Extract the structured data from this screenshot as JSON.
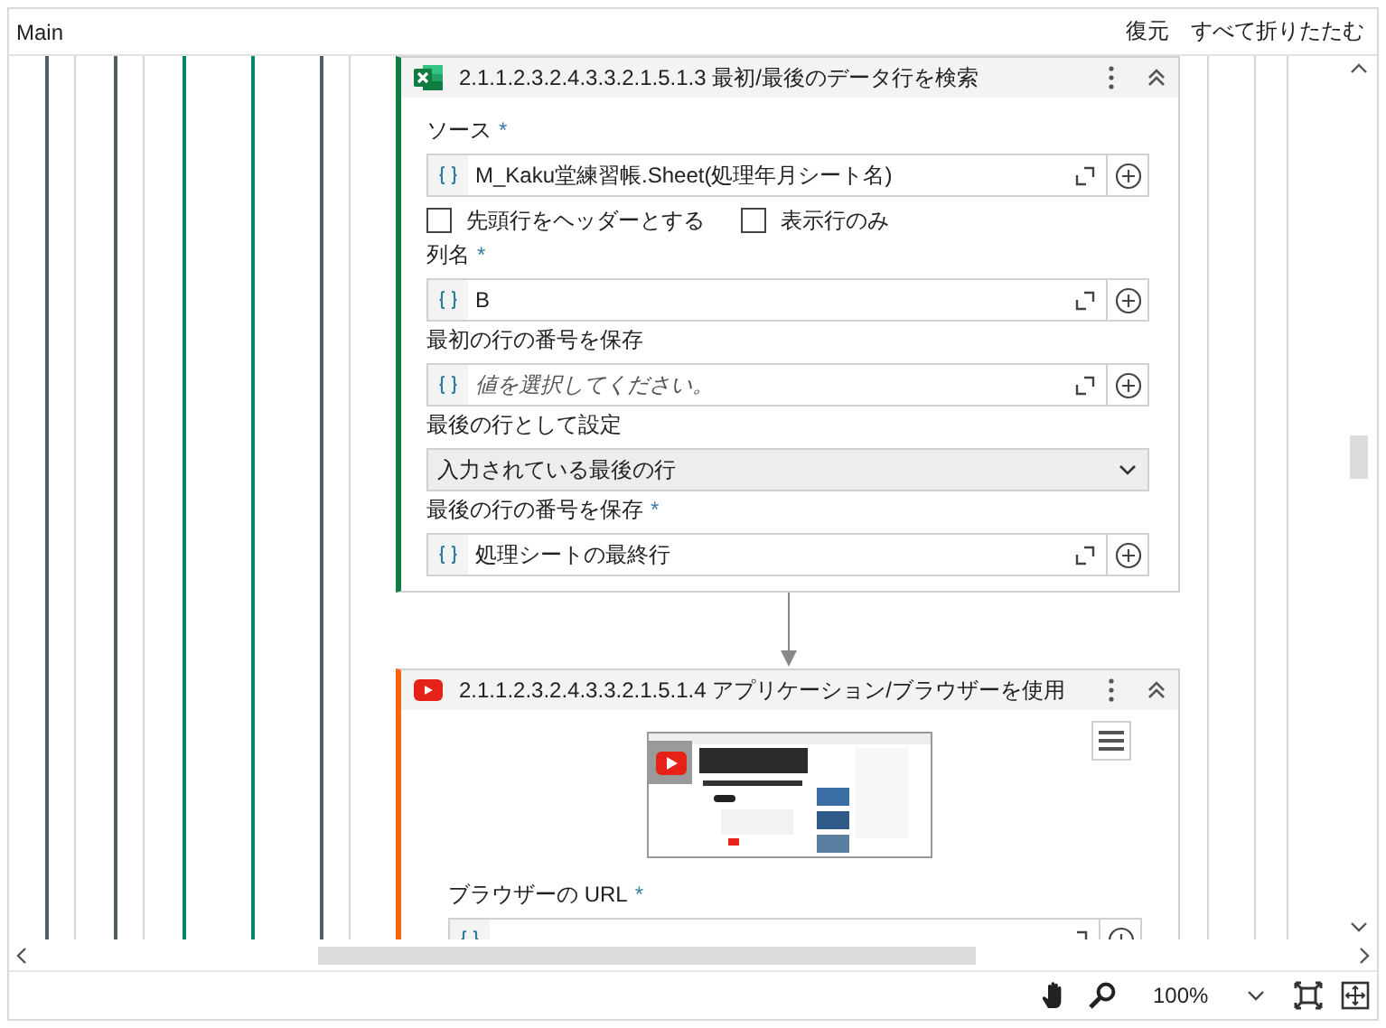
{
  "top_bar": {
    "title": "Main",
    "actions": [
      "復元",
      "すべて折りたたむ"
    ]
  },
  "actions": [
    {
      "kind": "excel",
      "color": "#107c41",
      "title": "2.1.1.2.3.2.4.3.3.2.1.5.1.3 最初/最後のデータ行を検索",
      "params": [
        {
          "kind": "field",
          "label": "ソース",
          "mark": "*",
          "value": "M_Kaku堂練習帳.Sheet(処理年月シート名)"
        },
        {
          "kind": "checkboxes",
          "items": [
            {
              "label": "先頭行をヘッダーとする",
              "checked": false
            },
            {
              "label": "表示行のみ",
              "checked": false
            }
          ]
        },
        {
          "kind": "field",
          "label": "列名",
          "mark": "*",
          "value": "B"
        },
        {
          "kind": "field",
          "label": "最初の行の番号を保存",
          "placeholder": "値を選択してください。"
        },
        {
          "kind": "dropdown",
          "label": "最後の行として設定",
          "value": "入力されている最後の行"
        },
        {
          "kind": "field",
          "label": "最後の行の番号を保存",
          "mark": "*",
          "value": "処理シートの最終行"
        }
      ]
    },
    {
      "kind": "browser",
      "color": "#f7630c",
      "title": "2.1.1.2.3.2.4.3.3.2.1.5.1.4 アプリケーション/ブラウザーを使用",
      "picture": {
        "kind": "picture"
      },
      "params": [
        {
          "kind": "field",
          "label": "ブラウザーの URL",
          "mark": "*"
        }
      ]
    }
  ],
  "zoom": {
    "value": "100%"
  }
}
